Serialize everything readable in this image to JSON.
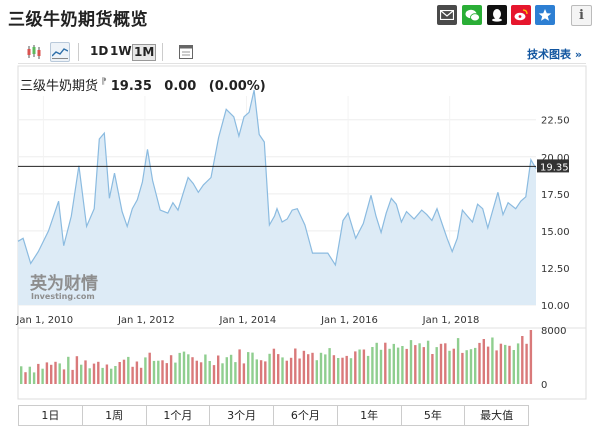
{
  "page": {
    "title": "三级牛奶期货概览",
    "chart_tools_link": "技术图表 »"
  },
  "share_icons": [
    {
      "name": "email-icon",
      "color": "#4a4a4a"
    },
    {
      "name": "wechat-icon",
      "color": "#2aae36"
    },
    {
      "name": "qq-icon",
      "color": "#111111"
    },
    {
      "name": "weibo-icon",
      "color": "#e6162d"
    },
    {
      "name": "favorite-star-icon",
      "color": "#2d7fd3"
    }
  ],
  "info_button": "i",
  "toolbar": {
    "periods": [
      "1D",
      "1W",
      "1M"
    ],
    "active_period": "1M"
  },
  "quote": {
    "name": "三级牛奶期货",
    "price": "19.35",
    "change": "0.00",
    "change_pct": "(0.00%)"
  },
  "watermark": {
    "brand": "英为财情",
    "sub": "Investing.com"
  },
  "ranges": [
    "1日",
    "1周",
    "1个月",
    "3个月",
    "6个月",
    "1年",
    "5年",
    "最大值"
  ],
  "colors": {
    "area_fill": "#ddebf6",
    "line": "#8bbbe0",
    "price_line": "#222222",
    "vol_up": "#8fce8f",
    "vol_down": "#d9797a"
  },
  "chart_data": [
    {
      "type": "area",
      "title": "",
      "x_ticks": [
        "Jan 1, 2010",
        "Jan 1, 2012",
        "Jan 1, 2014",
        "Jan 1, 2016",
        "Jan 1, 2018"
      ],
      "y_ticks": [
        "22.50",
        "20.00",
        "17.50",
        "15.00",
        "12.50",
        "10.00"
      ],
      "ylim": [
        10,
        24.1
      ],
      "xlim": [
        2009.5,
        2019.7
      ],
      "current_price_line": 19.35,
      "current_price_label": "19.35",
      "series": [
        {
          "x": [
            2009.5,
            2009.6,
            2009.75,
            2009.9,
            2010.1,
            2010.3,
            2010.4,
            2010.55,
            2010.7,
            2010.85,
            2011.0,
            2011.1,
            2011.2,
            2011.3,
            2011.4,
            2011.55,
            2011.65,
            2011.75,
            2011.85,
            2011.95,
            2012.05,
            2012.15,
            2012.3,
            2012.45,
            2012.55,
            2012.65,
            2012.75,
            2012.85,
            2012.95,
            2013.05,
            2013.15,
            2013.3,
            2013.45,
            2013.6,
            2013.75,
            2013.85,
            2013.95,
            2014.05,
            2014.15,
            2014.25,
            2014.35,
            2014.45,
            2014.55,
            2014.6,
            2014.7,
            2014.8,
            2014.9,
            2015.0,
            2015.15,
            2015.3,
            2015.45,
            2015.6,
            2015.75,
            2015.9,
            2016.0,
            2016.15,
            2016.3,
            2016.45,
            2016.55,
            2016.65,
            2016.75,
            2016.85,
            2016.95,
            2017.05,
            2017.15,
            2017.3,
            2017.45,
            2017.55,
            2017.65,
            2017.75,
            2017.85,
            2017.95,
            2018.05,
            2018.15,
            2018.25,
            2018.35,
            2018.45,
            2018.55,
            2018.65,
            2018.75,
            2018.85,
            2018.95,
            2019.05,
            2019.15,
            2019.3,
            2019.4,
            2019.5,
            2019.6,
            2019.7
          ],
          "values": [
            14.3,
            14.5,
            12.8,
            13.6,
            15.0,
            17.0,
            14.0,
            16.0,
            19.4,
            15.3,
            16.5,
            21.2,
            21.6,
            17.2,
            18.9,
            16.3,
            15.3,
            16.5,
            17.1,
            18.3,
            20.5,
            18.4,
            16.4,
            16.2,
            16.9,
            16.4,
            17.5,
            18.6,
            18.2,
            17.6,
            18.1,
            18.6,
            21.3,
            23.2,
            22.7,
            21.4,
            22.7,
            23.0,
            24.5,
            21.5,
            21.0,
            15.4,
            16.0,
            16.5,
            15.6,
            15.8,
            16.4,
            16.5,
            15.4,
            13.5,
            13.5,
            13.5,
            12.7,
            15.7,
            16.2,
            14.5,
            15.5,
            17.4,
            16.0,
            14.9,
            16.2,
            17.2,
            16.8,
            15.6,
            16.3,
            15.8,
            16.4,
            16.1,
            15.7,
            16.5,
            15.5,
            14.5,
            13.6,
            14.5,
            16.4,
            16.0,
            15.6,
            16.8,
            16.5,
            15.2,
            16.4,
            17.6,
            16.1,
            16.9,
            16.5,
            17.0,
            17.3,
            19.8,
            19.2
          ]
        }
      ]
    },
    {
      "type": "bar",
      "title": "",
      "y_ticks": [
        "8000",
        "0"
      ],
      "ylim": [
        0,
        8000
      ],
      "values_note": ""
    }
  ]
}
